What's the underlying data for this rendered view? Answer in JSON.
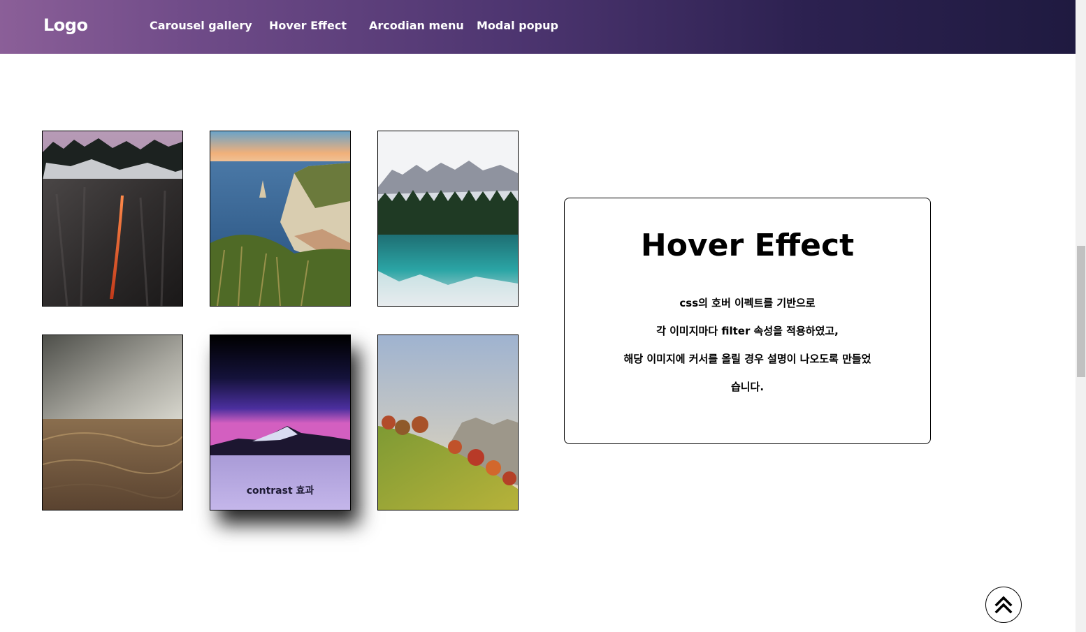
{
  "header": {
    "logo": "Logo",
    "nav": [
      "Carousel gallery",
      "Hover Effect",
      "Arcodian menu",
      "Modal popup"
    ]
  },
  "gallery": {
    "items": [
      {
        "name": "waterfall-cliff"
      },
      {
        "name": "sea-cliff"
      },
      {
        "name": "mountain-lake"
      },
      {
        "name": "desert-dunes"
      },
      {
        "name": "purple-mountain",
        "caption": "contrast 효과"
      },
      {
        "name": "autumn-hillside"
      }
    ]
  },
  "info": {
    "title": "Hover Effect",
    "lines": [
      "css의 호버 이펙트를 기반으로",
      "각 이미지마다 filter 속성을 적용하였고,",
      "해당 이미지에 커서를 올릴 경우 설명이 나오도록 만들었",
      "습니다."
    ]
  },
  "top_button": {
    "icon": "double-chevron-up-icon"
  }
}
